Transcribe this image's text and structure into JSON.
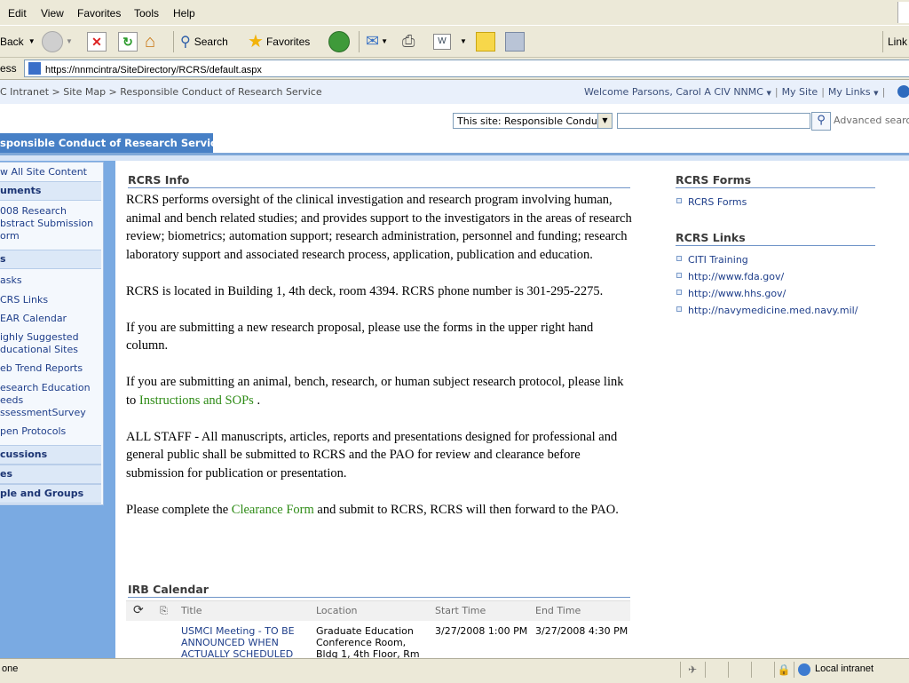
{
  "menu": [
    "Edit",
    "View",
    "Favorites",
    "Tools",
    "Help"
  ],
  "toolbar": {
    "back_label": "Back",
    "search_label": "Search",
    "favorites_label": "Favorites",
    "links_label": "Link"
  },
  "address": {
    "label": "ess",
    "url": "https://nnmcintra/SiteDirectory/RCRS/default.aspx"
  },
  "breadcrumb": "C Intranet > Site Map > Responsible Conduct of Research Service",
  "user_bar": {
    "welcome": "Welcome Parsons, Carol A CIV NNMC",
    "my_site": "My Site",
    "my_links": "My Links"
  },
  "search": {
    "scope": "This site: Responsible Conduct",
    "advanced": "Advanced search",
    "value": ""
  },
  "tab_active": "sponsible Conduct of Research Service",
  "leftnav": [
    {
      "label": "w All Site Content",
      "type": "link"
    },
    {
      "label": "uments",
      "type": "header"
    },
    {
      "label": "008 Research",
      "type": "link"
    },
    {
      "label": "bstract Submission",
      "type": "link"
    },
    {
      "label": "orm",
      "type": "link"
    },
    {
      "label": "s",
      "type": "header"
    },
    {
      "label": "asks",
      "type": "link"
    },
    {
      "label": "CRS Links",
      "type": "link"
    },
    {
      "label": "EAR Calendar",
      "type": "link"
    },
    {
      "label": "ighly Suggested",
      "type": "link"
    },
    {
      "label": "ducational Sites",
      "type": "link"
    },
    {
      "label": "eb Trend Reports",
      "type": "link"
    },
    {
      "label": "esearch Education",
      "type": "link"
    },
    {
      "label": "eeds",
      "type": "link"
    },
    {
      "label": "ssessmentSurvey",
      "type": "link"
    },
    {
      "label": "pen Protocols",
      "type": "link"
    },
    {
      "label": "cussions",
      "type": "header"
    },
    {
      "label": "es",
      "type": "header"
    },
    {
      "label": "ple and Groups",
      "type": "header"
    }
  ],
  "rcrs_info": {
    "title": "RCRS Info",
    "p1": "RCRS performs oversight of the clinical investigation and research program involving human, animal and bench related studies; and provides support to the investigators in the areas of research review; biometrics; automation support; research administration, personnel and funding; research laboratory support and associated research process, application, publication and education.",
    "p2": "RCRS is located in Building 1, 4th deck, room 4394.  RCRS phone number is 301-295-2275.",
    "p3": "If you are submitting a new research proposal, please use the forms in the upper right hand column.",
    "p4_pre": "If you are submitting an animal, bench, research, or human subject research protocol, please link to ",
    "p4_link": "Instructions and SOPs",
    "p4_post": " .",
    "p5": "ALL STAFF - All manuscripts, articles, reports and presentations designed for professional and general public shall be submitted to RCRS and the PAO for review and clearance before submission for publication or presentation.",
    "p6_pre": "Please complete the ",
    "p6_link": "Clearance Form",
    "p6_post": "  and submit to RCRS, RCRS will then forward to the PAO."
  },
  "forms": {
    "title": "RCRS Forms",
    "items": [
      "RCRS Forms"
    ]
  },
  "links": {
    "title": "RCRS Links",
    "items": [
      "CITI Training",
      "http://www.fda.gov/",
      "http://www.hhs.gov/",
      "http://navymedicine.med.navy.mil/"
    ]
  },
  "calendar": {
    "title": "IRB Calendar",
    "columns": [
      "Title",
      "Location",
      "Start Time",
      "End Time"
    ],
    "row": {
      "title_lines": [
        "USMCI Meeting - TO BE",
        "ANNOUNCED WHEN",
        "ACTUALLY SCHEDULED"
      ],
      "location_lines": [
        "Graduate Education",
        "Conference Room,",
        "Bldg 1, 4th Floor, Rm"
      ],
      "start": "3/27/2008 1:00 PM",
      "end": "3/27/2008 4:30 PM"
    }
  },
  "status": {
    "text": "one",
    "zone": "Local intranet"
  }
}
